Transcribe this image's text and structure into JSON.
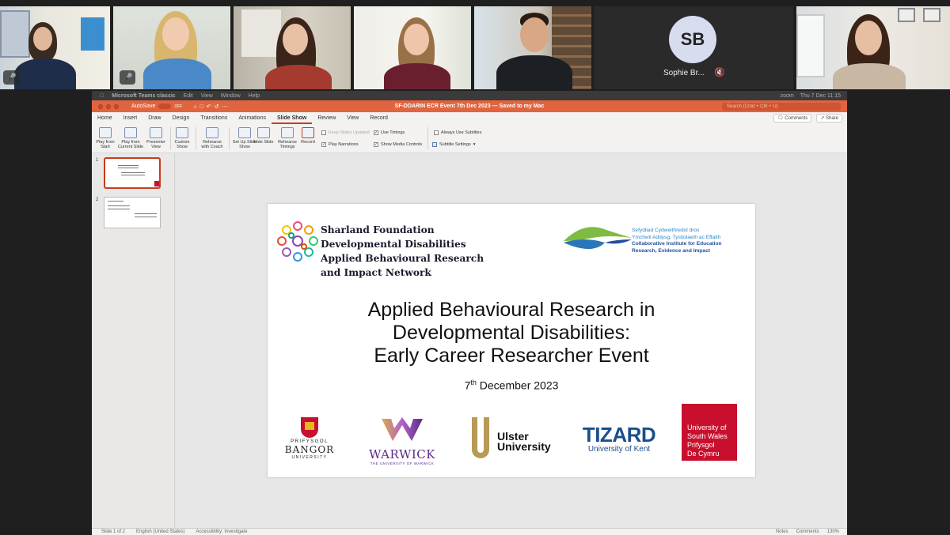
{
  "participants": [
    {
      "id": "p1",
      "muted": true
    },
    {
      "id": "p2",
      "muted": true
    },
    {
      "id": "p3",
      "muted": false
    },
    {
      "id": "p4",
      "muted": false
    },
    {
      "id": "p5",
      "muted": false
    },
    {
      "id": "p6",
      "initials": "SB",
      "name": "Sophie Br...",
      "muted": true
    },
    {
      "id": "p7",
      "muted": false
    }
  ],
  "macbar": {
    "app": "Microsoft Teams classic",
    "menus": [
      "Edit",
      "View",
      "Window",
      "Help"
    ],
    "clock": "Thu 7 Dec  11:15",
    "zoom": "zoom"
  },
  "window": {
    "autosave_label": "AutoSave",
    "autosave_state": "OFF",
    "title": "SF-DDARIN ECR Event 7th Dec 2023 — Saved to my Mac",
    "search_placeholder": "Search (Cmd + Ctrl + U)"
  },
  "ribbon_tabs": [
    "Home",
    "Insert",
    "Draw",
    "Design",
    "Transitions",
    "Animations",
    "Slide Show",
    "Review",
    "View",
    "Record"
  ],
  "active_tab": "Slide Show",
  "ribbon_right": {
    "comments": "Comments",
    "share": "Share"
  },
  "ribbon_buttons": {
    "play_start": "Play from Start",
    "play_current": "Play from Current Slide",
    "presenter": "Presenter View",
    "custom": "Custom Show",
    "rehearse_coach": "Rehearse with Coach",
    "setup": "Set Up Slide Show",
    "hide": "Hide Slide",
    "rehearse_timings": "Rehearse Timings",
    "record": "Record"
  },
  "ribbon_checks": {
    "keep_updated": "Keep Slides Updated",
    "use_timings": "Use Timings",
    "play_narrations": "Play Narrations",
    "show_media": "Show Media Controls",
    "always_subtitles": "Always Use Subtitles",
    "subtitle_settings": "Subtitle Settings"
  },
  "thumbnails": [
    "1",
    "2"
  ],
  "slide": {
    "sharland": "Sharland Foundation Developmental Disabilities Applied Behavioural Research and Impact Network",
    "ciee_welsh_1": "Sefydliad Cydweithredol dros",
    "ciee_welsh_2": "Ymchwil Addysg, Tystiolaeth ac Effaith",
    "ciee_en_1": "Collaborative Institute for Education",
    "ciee_en_2": "Research, Evidence and Impact",
    "title_1": "Applied Behavioural Research in",
    "title_2": "Developmental Disabilities:",
    "title_3": "Early Career Researcher Event",
    "date_day": "7",
    "date_sup": "th",
    "date_rest": " December 2023",
    "bangor_1": "PRIFYSGOL",
    "bangor_2": "BANGOR",
    "bangor_3": "UNIVERSITY",
    "warwick_1": "WARWICK",
    "warwick_2": "THE UNIVERSITY OF WARWICK",
    "ulster_1": "Ulster",
    "ulster_2": "University",
    "tizard_1": "TIZARD",
    "tizard_2": "University of Kent",
    "usw_1": "University of",
    "usw_2": "South Wales",
    "usw_3": "Prifysgol",
    "usw_4": "De Cymru"
  },
  "status": {
    "slide_count": "Slide 1 of 2",
    "language": "English (United States)",
    "accessibility": "Accessibility: Investigate",
    "notes": "Notes",
    "comments": "Comments",
    "zoom": "130%"
  },
  "colors": {
    "accent": "#c43e1c",
    "titlebar": "#e0653f",
    "usw": "#c8102e",
    "tizard": "#1a4f8b",
    "warwick": "#5b2a86"
  }
}
